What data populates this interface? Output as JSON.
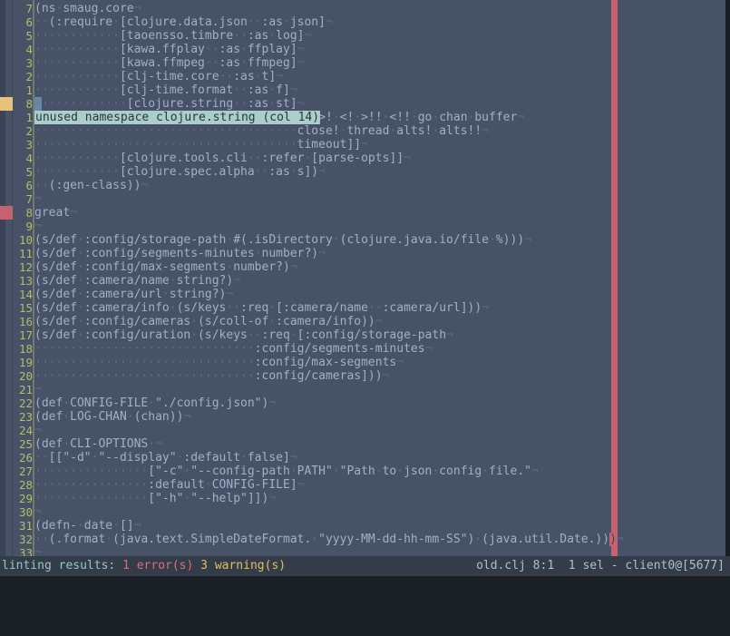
{
  "window": {
    "title": "old.clj",
    "theme_bg": "#475267",
    "gutter_bg": "#3b4456",
    "accent_error": "#c4626f",
    "accent_warning": "#e6c27a",
    "tooltip_bg": "#a9cfc8"
  },
  "gutter": {
    "line_numbers": [
      "7",
      "6",
      "5",
      "4",
      "3",
      "2",
      "1",
      "8",
      "1",
      "2",
      "3",
      "4",
      "5",
      "6",
      "7",
      "8",
      "9",
      "10",
      "11",
      "12",
      "13",
      "14",
      "15",
      "16",
      "17",
      "18",
      "19",
      "20",
      "21",
      "22",
      "23",
      "24",
      "25",
      "26",
      "27",
      "28",
      "29",
      "30",
      "31",
      "32",
      "33"
    ],
    "markers": [
      {
        "line_index": 7,
        "kind": "warning-marker",
        "color": "#e6c27a"
      },
      {
        "line_index": 15,
        "kind": "error-marker",
        "color": "#c4626f"
      }
    ]
  },
  "code": {
    "lines": [
      "(ns·smaug.core¬",
      "··(:require·[clojure.data.json··:as·json]¬",
      "············[taoensso.timbre··:as·log]¬",
      "············[kawa.ffplay··:as·ffplay]¬",
      "············[kawa.ffmpeg··:as·ffmpeg]¬",
      "············[clj-time.core··:as·t]¬",
      "············[clj-time.format··:as·f]¬",
      "·············[clojure.string··:as·st]¬",
      "············[clojure.core.async·:refer·[>!·<!·>!!·<!!·go·chan·buffer¬",
      "·····································close!·thread·alts!·alts!!¬",
      "·····································timeout]]¬",
      "············[clojure.tools.cli··:refer·[parse-opts]]¬",
      "············[clojure.spec.alpha··:as·s])¬",
      "··(:gen-class))¬",
      "¬",
      "great¬",
      "¬",
      "(s/def·:config/storage-path·#(.isDirectory·(clojure.java.io/file·%)))¬",
      "(s/def·:config/segments-minutes·number?)¬",
      "(s/def·:config/max-segments·number?)¬",
      "(s/def·:camera/name·string?)¬",
      "(s/def·:camera/url·string?)¬",
      "(s/def·:camera/info·(s/keys··:req·[:camera/name··:camera/url]))¬",
      "(s/def·:config/cameras·(s/coll-of·:camera/info))¬",
      "(s/def·:config/uration·(s/keys··:req·[:config/storage-path¬",
      "·······························:config/segments-minutes¬",
      "·······························:config/max-segments¬",
      "·······························:config/cameras]))¬",
      "¬",
      "(def·CONFIG-FILE·\"./config.json\")¬",
      "(def·LOG-CHAN·(chan))¬",
      "¬",
      "(def·CLI-OPTIONS·¬",
      "··[[\"-d\"·\"--display\"·:default·false]¬",
      "················[\"-c\"·\"--config-path·PATH\"·\"Path·to·json·config·file.\"¬",
      "················:default·CONFIG-FILE]¬",
      "················[\"-h\"·\"--help\"]])¬",
      "¬",
      "(defn-·date·[]¬",
      "··(.format·(java.text.SimpleDateFormat.·\"yyyy-MM-dd-hh-mm-SS\")·(java.util.Date.)))¬",
      "¬"
    ]
  },
  "diagnostic_tooltip": {
    "text": "unused namespace clojure.string (col 14)",
    "line_index": 8,
    "severity": "warning"
  },
  "selection": {
    "line_index": 7,
    "columns": 1,
    "description": "single-character selection"
  },
  "statusbar": {
    "left_label": "linting results:",
    "error_count": "1 error(s)",
    "warning_count": "3 warning(s)",
    "right": "old.clj 8:1  1 sel - client0@[5677]"
  }
}
